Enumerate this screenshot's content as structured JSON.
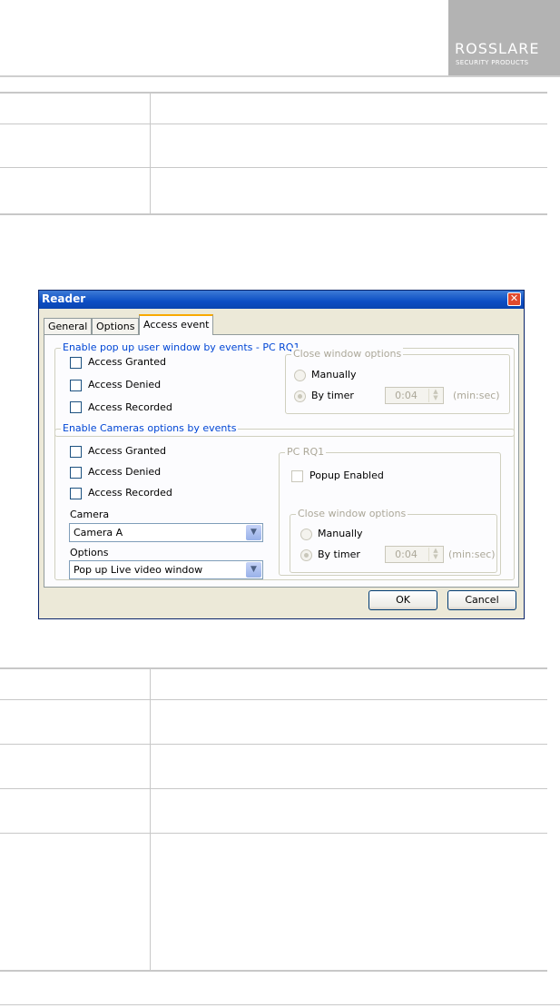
{
  "brand": {
    "name": "ROSSLARE",
    "tagline": "SECURITY PRODUCTS",
    "background": "#b3b3b3"
  },
  "dialog": {
    "title": "Reader",
    "tabs": [
      {
        "label": "General",
        "active": false
      },
      {
        "label": "Options",
        "active": false
      },
      {
        "label": "Access event",
        "active": true
      }
    ],
    "popup_group": {
      "legend": "Enable pop up user window by events - PC RQ1",
      "checkboxes": [
        {
          "label": "Access Granted",
          "checked": false
        },
        {
          "label": "Access Denied",
          "checked": false
        },
        {
          "label": "Access Recorded",
          "checked": false
        }
      ],
      "close_window": {
        "legend": "Close window options",
        "manually_label": "Manually",
        "timer_label": "By timer",
        "timer_value": "0:04",
        "unit": "(min:sec)",
        "selected": "By timer",
        "enabled": false
      }
    },
    "cameras_group": {
      "legend": "Enable Cameras options by events",
      "checkboxes": [
        {
          "label": "Access Granted",
          "checked": false
        },
        {
          "label": "Access Denied",
          "checked": false
        },
        {
          "label": "Access Recorded",
          "checked": false
        }
      ],
      "camera_label": "Camera",
      "camera_value": "Camera A",
      "options_label": "Options",
      "options_value": "Pop up Live video window",
      "pc_group": {
        "legend": "PC RQ1",
        "popup_label": "Popup Enabled",
        "popup_checked": false,
        "close_window": {
          "legend": "Close window options",
          "manually_label": "Manually",
          "timer_label": "By timer",
          "timer_value": "0:04",
          "unit": "(min:sec)",
          "selected": "By timer",
          "enabled": false
        }
      }
    },
    "buttons": {
      "ok": "OK",
      "cancel": "Cancel"
    }
  }
}
